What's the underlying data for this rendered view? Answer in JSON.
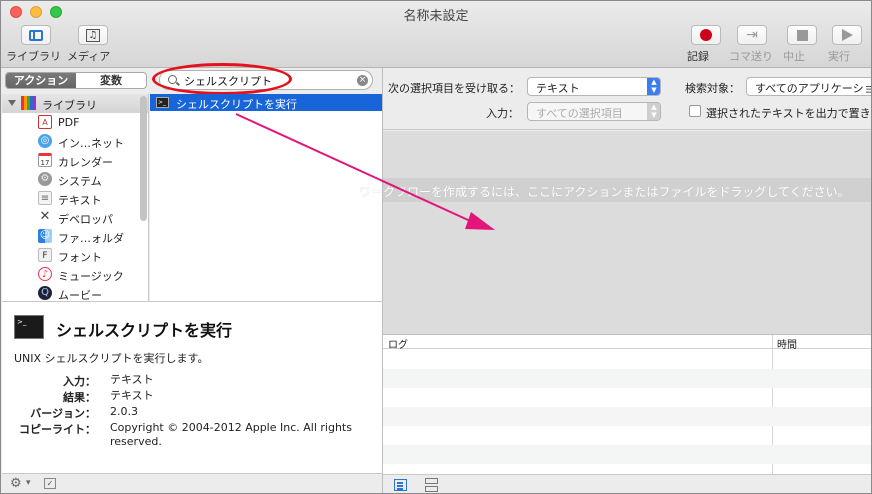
{
  "window": {
    "title": "名称未設定"
  },
  "toolbar": {
    "library_label": "ライブラリ",
    "media_label": "メディア",
    "record_label": "記録",
    "step_label": "コマ送り",
    "stop_label": "中止",
    "run_label": "実行"
  },
  "left": {
    "seg_actions": "アクション",
    "seg_variables": "変数",
    "search_value": "シェルスクリプト",
    "library_root": "ライブラリ",
    "library_items": [
      {
        "label": "PDF",
        "icon": "pdf-icon"
      },
      {
        "label": "インターネット",
        "display": "イン…ネット",
        "icon": "internet-icon"
      },
      {
        "label": "カレンダー",
        "icon": "calendar-icon"
      },
      {
        "label": "システム",
        "icon": "system-icon"
      },
      {
        "label": "テキスト",
        "icon": "text-icon"
      },
      {
        "label": "デベロッパ",
        "icon": "developer-icon"
      },
      {
        "label": "ファイルとフォルダ",
        "display": "ファ…ォルダ",
        "icon": "finder-icon"
      },
      {
        "label": "フォント",
        "icon": "font-icon"
      },
      {
        "label": "ミュージック",
        "icon": "music-icon"
      },
      {
        "label": "ムービー",
        "icon": "movie-icon"
      }
    ],
    "action_result": "シェルスクリプトを実行"
  },
  "description": {
    "title": "シェルスクリプトを実行",
    "subtitle": "UNIX シェルスクリプトを実行します。",
    "input_key": "入力：",
    "input_val": "テキスト",
    "result_key": "結果：",
    "result_val": "テキスト",
    "version_key": "バージョン：",
    "version_val": "2.0.3",
    "copyright_key": "コピーライト：",
    "copyright_val": "Copyright © 2004-2012 Apple Inc.  All rights reserved."
  },
  "workflow": {
    "receives_label": "次の選択項目を受け取る：",
    "receives_value": "テキスト",
    "search_target_label": "検索対象：",
    "search_target_value": "すべてのアプリケーション",
    "input_label": "入力：",
    "input_value": "すべての選択項目",
    "replace_label": "選択されたテキストを出力で置き換える",
    "drop_hint": "ワークフローを作成するには、ここにアクションまたはファイルをドラッグしてください。"
  },
  "log": {
    "col_log": "ログ",
    "col_time": "時間"
  },
  "colors": {
    "selection": "#1765d8",
    "annotation": "#e4111c",
    "arrow": "#e3147a"
  }
}
